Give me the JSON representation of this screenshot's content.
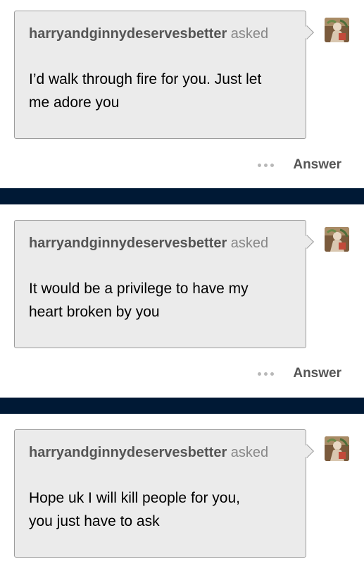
{
  "asks": [
    {
      "asker": "harryandginnydeservesbetter",
      "asked_label": "asked",
      "question_lines": [
        "I’d walk through fire for you. Just let",
        "me adore you"
      ],
      "answer_label": "Answer",
      "more_icon": "ellipsis-icon",
      "avatar_icon": "avatar-image"
    },
    {
      "asker": "harryandginnydeservesbetter",
      "asked_label": "asked",
      "question_lines": [
        "It would be a privilege to have my",
        "heart broken by you"
      ],
      "answer_label": "Answer",
      "more_icon": "ellipsis-icon",
      "avatar_icon": "avatar-image"
    },
    {
      "asker": "harryandginnydeservesbetter",
      "asked_label": "asked",
      "question_lines": [
        "Hope uk I will kill people for you,",
        "you just have to ask"
      ],
      "avatar_icon": "avatar-image"
    }
  ],
  "colors": {
    "divider": "#001935",
    "bubble_bg": "#ebebeb",
    "bubble_border": "#9c9c9c",
    "asker_text": "#555555",
    "asked_text": "#888888"
  }
}
